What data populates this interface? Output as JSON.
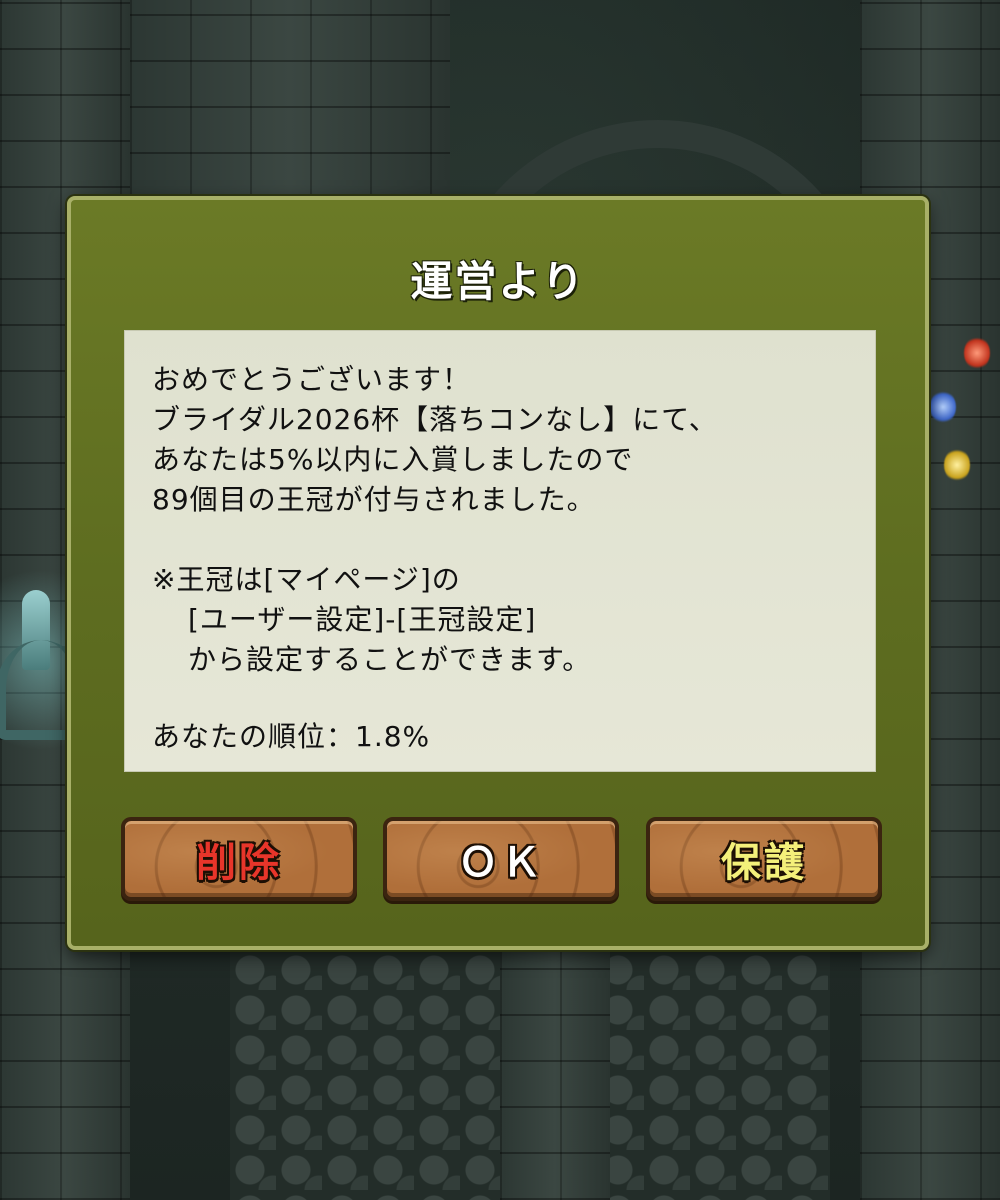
{
  "dialog": {
    "title": "運営より",
    "message_lines": [
      "おめでとうございます！",
      "ブライダル2026杯【落ちコンなし】にて、",
      "あなたは5%以内に入賞しましたので",
      "89個目の王冠が付与されました。",
      "",
      "※王冠は[マイページ]の",
      "[ユーザー設定]-[王冠設定]",
      "から設定することができます。",
      "",
      "あなたの順位：1.8%"
    ]
  },
  "buttons": {
    "delete": {
      "label": "削除",
      "color": "#e8352a"
    },
    "ok": {
      "label": "ＯＫ",
      "color": "#ffffff"
    },
    "protect": {
      "label": "保護",
      "color": "#f4f07a"
    }
  },
  "colors": {
    "dialog_bg": "#5e6d20",
    "message_bg": "#e2e3d2",
    "button_wood": "#a86635"
  }
}
